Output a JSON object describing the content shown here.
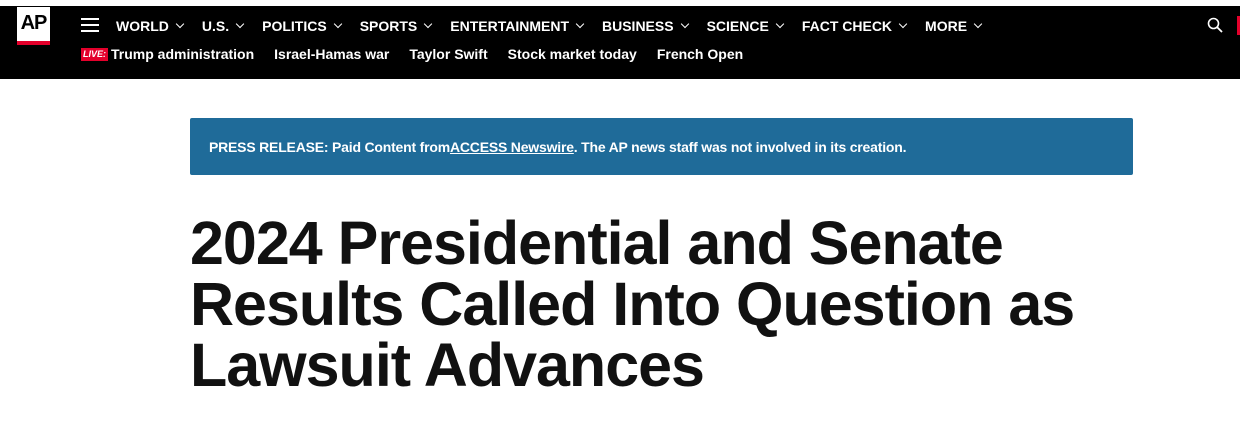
{
  "brand": {
    "logo_text": "AP",
    "accent_color": "#e4002b",
    "banner_color": "#1f6b99"
  },
  "nav": {
    "menu_icon": "hamburger-menu-icon",
    "items": [
      {
        "label": "WORLD"
      },
      {
        "label": "U.S."
      },
      {
        "label": "POLITICS"
      },
      {
        "label": "SPORTS"
      },
      {
        "label": "ENTERTAINMENT"
      },
      {
        "label": "BUSINESS"
      },
      {
        "label": "SCIENCE"
      },
      {
        "label": "FACT CHECK"
      },
      {
        "label": "MORE"
      }
    ],
    "search_icon": "search-icon"
  },
  "trending": {
    "live_badge": "LIVE:",
    "items": [
      {
        "label": "Trump administration"
      },
      {
        "label": "Israel-Hamas war"
      },
      {
        "label": "Taylor Swift"
      },
      {
        "label": "Stock market today"
      },
      {
        "label": "French Open"
      }
    ]
  },
  "press_release": {
    "prefix": "PRESS RELEASE: Paid Content from ",
    "source_link": "ACCESS Newswire",
    "suffix": ". The AP news staff was not involved in its creation."
  },
  "article": {
    "headline": "2024 Presidential and Senate Results Called Into Question as Lawsuit Advances"
  }
}
